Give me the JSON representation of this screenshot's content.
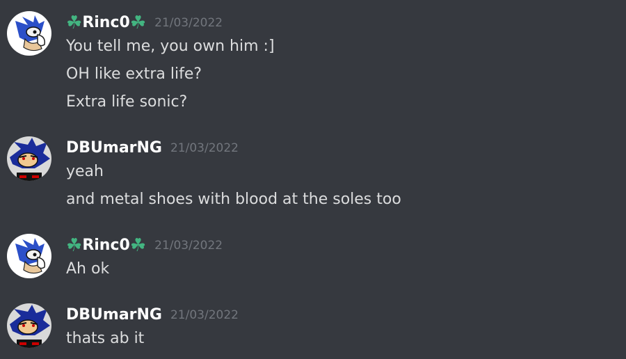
{
  "groups": [
    {
      "username": "Rinc0",
      "decoration": "four-leaf-clover",
      "decoration_glyph": "☘",
      "timestamp": "21/03/2022",
      "avatar": "sonic-thinking-avatar",
      "messages": [
        "You tell me, you own him :]",
        "OH like extra life?",
        "Extra life sonic?"
      ]
    },
    {
      "username": "DBUmarNG",
      "timestamp": "21/03/2022",
      "avatar": "dark-sonic-avatar",
      "messages": [
        "yeah",
        "and metal shoes with blood at the soles too"
      ]
    },
    {
      "username": "Rinc0",
      "decoration": "four-leaf-clover",
      "decoration_glyph": "☘",
      "timestamp": "21/03/2022",
      "avatar": "sonic-thinking-avatar",
      "messages": [
        "Ah ok"
      ]
    },
    {
      "username": "DBUmarNG",
      "timestamp": "21/03/2022",
      "avatar": "dark-sonic-avatar",
      "messages": [
        "thats ab it"
      ]
    }
  ],
  "colors": {
    "background": "#36393f",
    "username": "#ffffff",
    "message_text": "#dcddde",
    "timestamp": "#72767d",
    "clover": "#43b581"
  }
}
